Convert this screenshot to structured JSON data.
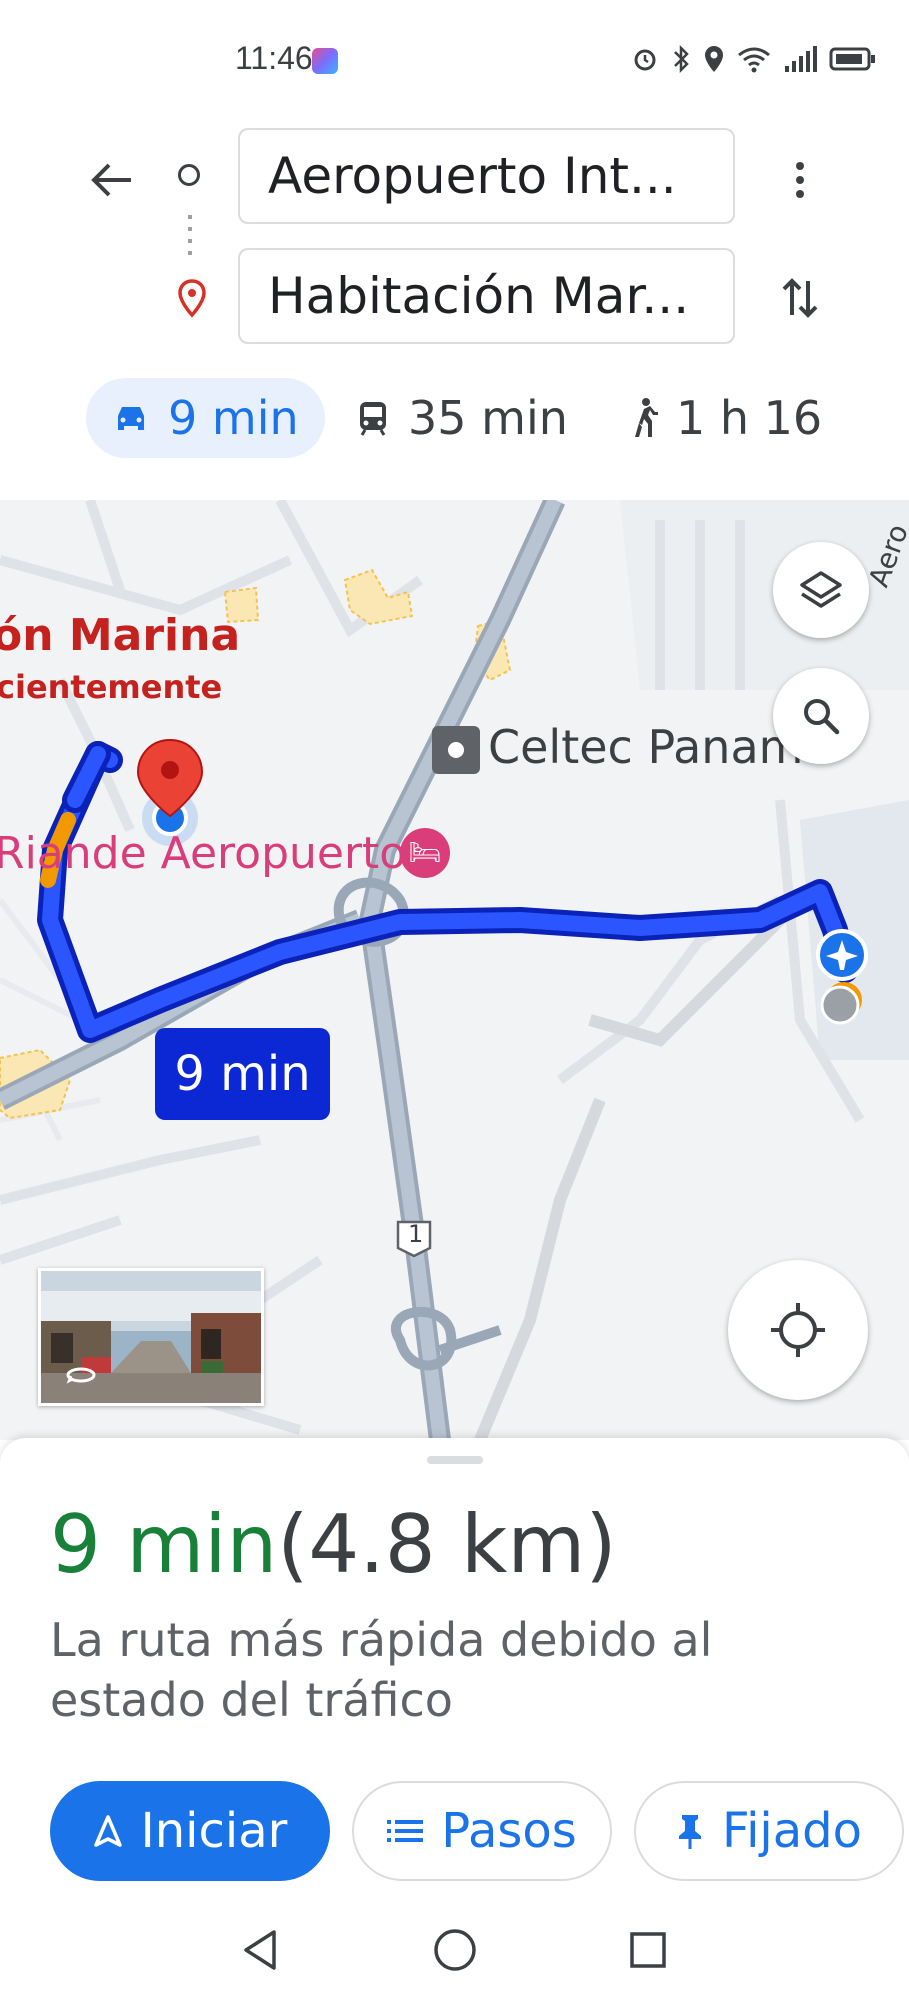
{
  "status": {
    "time": "11:46"
  },
  "route": {
    "origin": "Aeropuerto Int...",
    "destination": "Habitación Mar..."
  },
  "modes": [
    {
      "label": "9 min",
      "icon": "car-icon",
      "active": true
    },
    {
      "label": "35 min",
      "icon": "transit-icon",
      "active": false
    },
    {
      "label": "1 h 16",
      "icon": "walk-icon",
      "active": false
    }
  ],
  "map": {
    "labels": {
      "marina": "ón Marina",
      "recent": "cientemente",
      "celtec": "Celtec Panama",
      "riande": "Riande Aeropuerto",
      "aero_road": "Aero"
    },
    "route_time": "9 min",
    "highway_shield": "1"
  },
  "sheet": {
    "duration": "9 min",
    "distance": "(4.8 km)",
    "description": "La ruta más rápida debido al estado del tráfico",
    "buttons": {
      "start": "Iniciar",
      "steps": "Pasos",
      "pin": "Fijado"
    }
  },
  "colors": {
    "route": "#1f3fe0",
    "accent": "#1a73e8",
    "duration_green": "#188038"
  }
}
